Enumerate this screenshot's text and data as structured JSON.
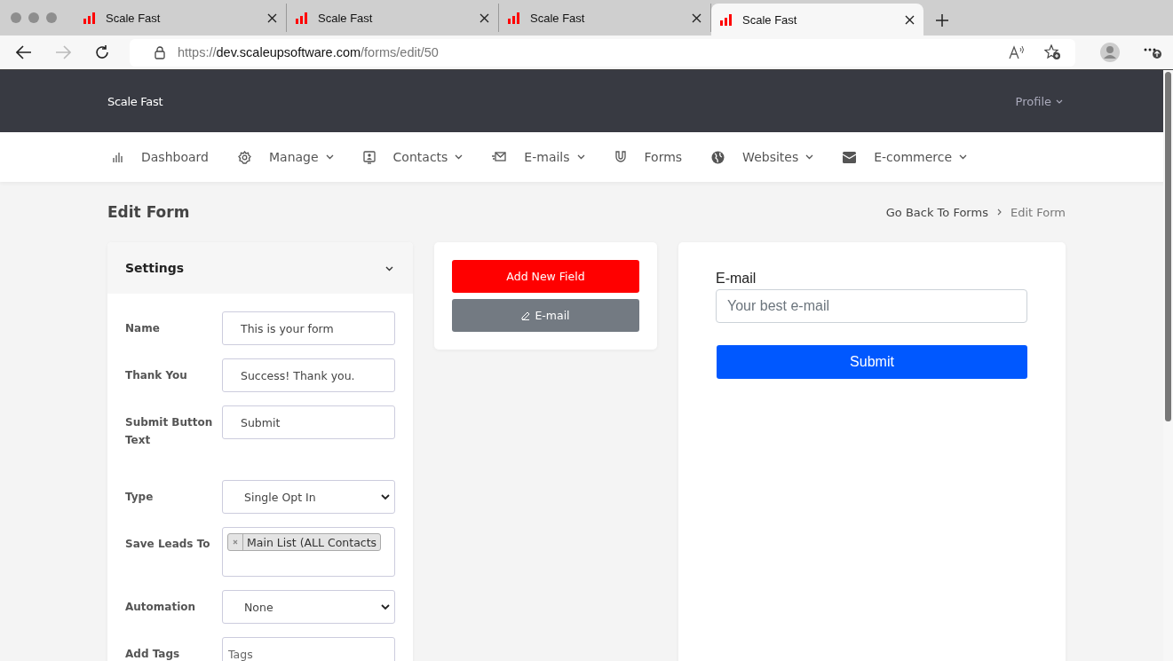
{
  "browser": {
    "tabs": [
      {
        "title": "Scale Fast",
        "selected": false
      },
      {
        "title": "Scale Fast",
        "selected": false
      },
      {
        "title": "Scale Fast",
        "selected": false
      },
      {
        "title": "Scale Fast",
        "selected": true
      }
    ],
    "url": {
      "scheme": "https://",
      "host": "dev.scaleupsoftware.com",
      "path": "/forms/edit/50"
    }
  },
  "header": {
    "brand": "Scale Fast",
    "profile": "Profile"
  },
  "nav": [
    {
      "label": "Dashboard",
      "has_menu": false
    },
    {
      "label": "Manage",
      "has_menu": true
    },
    {
      "label": "Contacts",
      "has_menu": true
    },
    {
      "label": "E-mails",
      "has_menu": true
    },
    {
      "label": "Forms",
      "has_menu": false
    },
    {
      "label": "Websites",
      "has_menu": true
    },
    {
      "label": "E-commerce",
      "has_menu": true
    }
  ],
  "page": {
    "title": "Edit Form",
    "breadcrumb": [
      "Go Back To Forms",
      "Edit Form"
    ]
  },
  "settings": {
    "title": "Settings",
    "expanded": true,
    "fields": [
      {
        "kind": "text",
        "label": "Name",
        "value": "This is your form"
      },
      {
        "kind": "text",
        "label": "Thank You",
        "value": "Success! Thank you."
      },
      {
        "kind": "text",
        "label": "Submit Button Text",
        "value": "Submit"
      },
      {
        "kind": "select",
        "label": "Type",
        "value": "Single Opt In"
      },
      {
        "kind": "tags",
        "label": "Save Leads To",
        "tags": [
          "Main List (ALL Contacts"
        ]
      },
      {
        "kind": "select",
        "label": "Automation",
        "value": "None"
      },
      {
        "kind": "text",
        "label": "Add Tags",
        "placeholder": "Tags"
      }
    ]
  },
  "builder": {
    "add_button": "Add New Field",
    "fields": [
      "E-mail"
    ]
  },
  "preview": {
    "field_label": "E-mail",
    "placeholder": "Your best e-mail",
    "submit": "Submit"
  }
}
